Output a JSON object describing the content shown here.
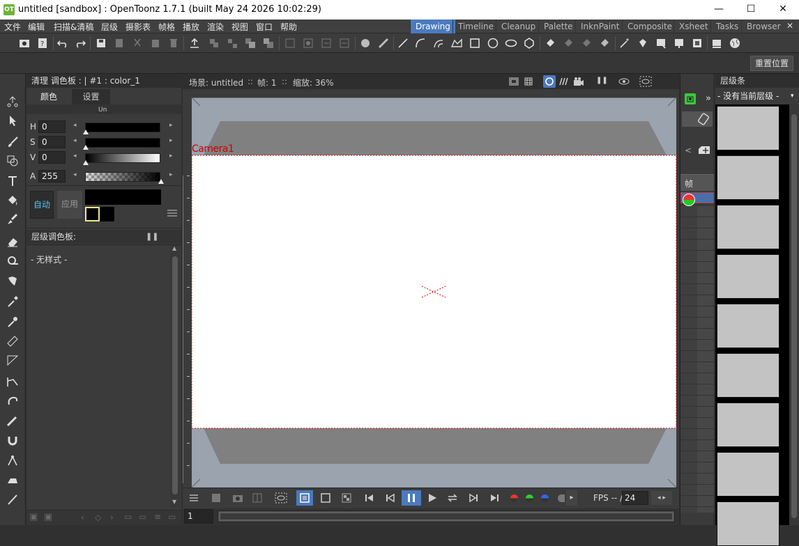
{
  "window": {
    "title": "untitled [sandbox] : OpenToonz 1.7.1 (built May 24 2026 10:02:29)",
    "app_icon": "OT",
    "minimize": "—",
    "maximize": "☐",
    "close": "✕"
  },
  "menu": [
    "文件",
    "编辑",
    "扫描&清稿",
    "层级",
    "摄影表",
    "帧格",
    "播放",
    "渲染",
    "视图",
    "窗口",
    "帮助"
  ],
  "rooms": [
    {
      "label": "Drawing",
      "active": true
    },
    {
      "label": "Timeline",
      "active": false
    },
    {
      "label": "Cleanup",
      "active": false
    },
    {
      "label": "Palette",
      "active": false
    },
    {
      "label": "InknPaint",
      "active": false
    },
    {
      "label": "Composite",
      "active": false
    },
    {
      "label": "Xsheet",
      "active": false
    },
    {
      "label": "Tasks",
      "active": false
    },
    {
      "label": "Browser",
      "active": false
    }
  ],
  "toolbar2": {
    "reset_position": "重置位置"
  },
  "style_editor": {
    "header": "清理 调色板 : | #1 : color_1",
    "tab_color": "颜色",
    "tab_settings": "设置",
    "tiny_label": "Un",
    "channels": [
      {
        "label": "H",
        "value": "0"
      },
      {
        "label": "S",
        "value": "0"
      },
      {
        "label": "V",
        "value": "0"
      },
      {
        "label": "A",
        "value": "255"
      }
    ],
    "auto_button": "自动",
    "apply_button": "应用",
    "current_color": "#000000",
    "accent": "#f0e68c"
  },
  "level_palette": {
    "header": "层级调色板:",
    "empty_text": "- 无样式 -"
  },
  "viewer": {
    "header_scene": "场景: untitled",
    "header_sep1": "::",
    "header_frame": "帧: 1",
    "header_sep2": "::",
    "header_zoom": "缩放: 36%",
    "camera_label": "Camera1",
    "fps_label": "FPS -- /",
    "fps_value": "24",
    "frame_value": "1",
    "outer_color": "#9aa3ae",
    "band_color": "#808080",
    "camera_border": "#cc0000"
  },
  "xsheet": {
    "frame_label": "帧",
    "expand": "»"
  },
  "level_strip": {
    "header": "层级条",
    "selector": "- 没有当前层级 -",
    "thumbnail_count": 9
  }
}
